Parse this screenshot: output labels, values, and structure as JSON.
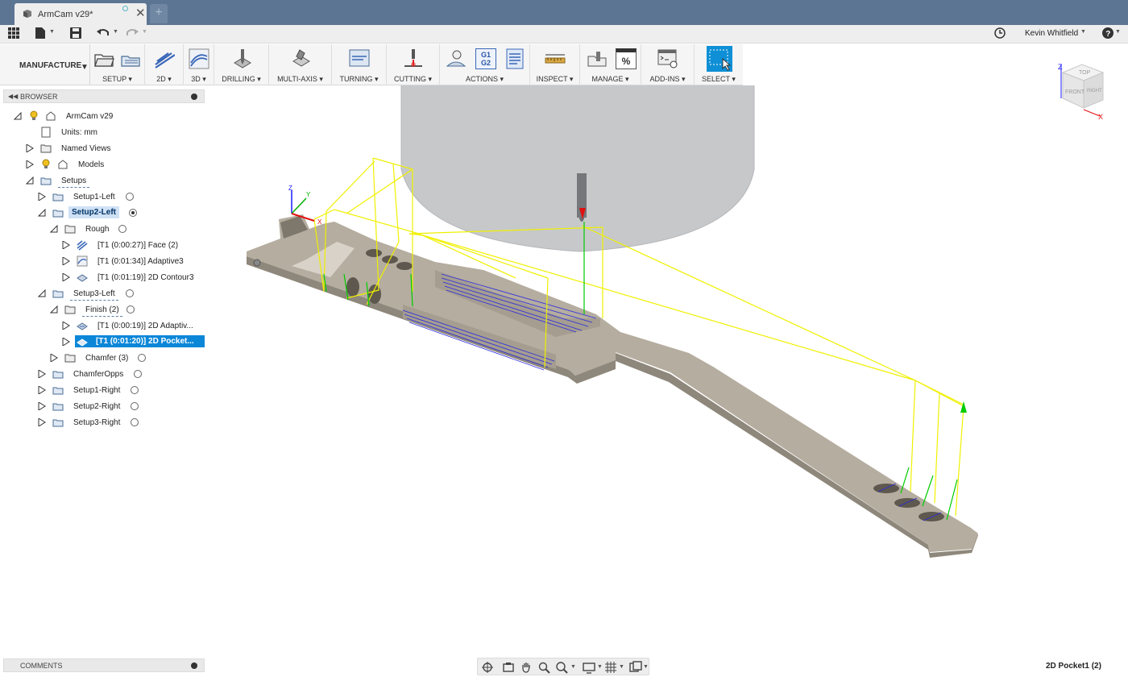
{
  "window": {
    "tab_title": "ArmCam v29*",
    "new_tab": "+"
  },
  "topbar": {
    "user": "Kevin Whitfield"
  },
  "ribbon": {
    "workspace": "MANUFACTURE",
    "groups": [
      {
        "label": "SETUP"
      },
      {
        "label": "2D"
      },
      {
        "label": "3D"
      },
      {
        "label": "DRILLING"
      },
      {
        "label": "MULTI-AXIS"
      },
      {
        "label": "TURNING"
      },
      {
        "label": "CUTTING"
      },
      {
        "label": "ACTIONS"
      },
      {
        "label": "INSPECT"
      },
      {
        "label": "MANAGE"
      },
      {
        "label": "ADD-INS"
      },
      {
        "label": "SELECT"
      }
    ],
    "actions_g1g2": "G1 G2",
    "manage_percent": "%"
  },
  "browser": {
    "title": "BROWSER",
    "items": [
      {
        "label": "ArmCam v29"
      },
      {
        "label": "Units: mm"
      },
      {
        "label": "Named Views"
      },
      {
        "label": "Models"
      },
      {
        "label": "Setups"
      },
      {
        "label": "Setup1-Left"
      },
      {
        "label": "Setup2-Left"
      },
      {
        "label": "Rough"
      },
      {
        "label": "[T1 (0:00:27)] Face (2)"
      },
      {
        "label": "[T1 (0:01:34)] Adaptive3"
      },
      {
        "label": "[T1 (0:01:19)] 2D Contour3"
      },
      {
        "label": "Setup3-Left"
      },
      {
        "label": "Finish (2)"
      },
      {
        "label": "[T1 (0:00:19)] 2D Adaptiv..."
      },
      {
        "label": "[T1 (0:01:20)] 2D Pocket..."
      },
      {
        "label": "Chamfer (3)"
      },
      {
        "label": "ChamferOpps"
      },
      {
        "label": "Setup1-Right"
      },
      {
        "label": "Setup2-Right"
      },
      {
        "label": "Setup3-Right"
      }
    ]
  },
  "viewcube": {
    "top": "TOP",
    "front": "FRONT",
    "right": "RIGHT",
    "axis_z": "Z",
    "axis_x": "X"
  },
  "triad": {
    "z": "Z",
    "y": "Y",
    "x": "X"
  },
  "comments": {
    "title": "COMMENTS"
  },
  "status": {
    "selection": "2D Pocket1 (2)"
  },
  "colors": {
    "titlebar": "#5c7592",
    "selection": "#0c87d8",
    "toolpath_rapid": "#f0f000",
    "toolpath_lead": "#00cc00",
    "toolpath_cut": "#2a2ae0",
    "stock": "#b5ad9f"
  }
}
